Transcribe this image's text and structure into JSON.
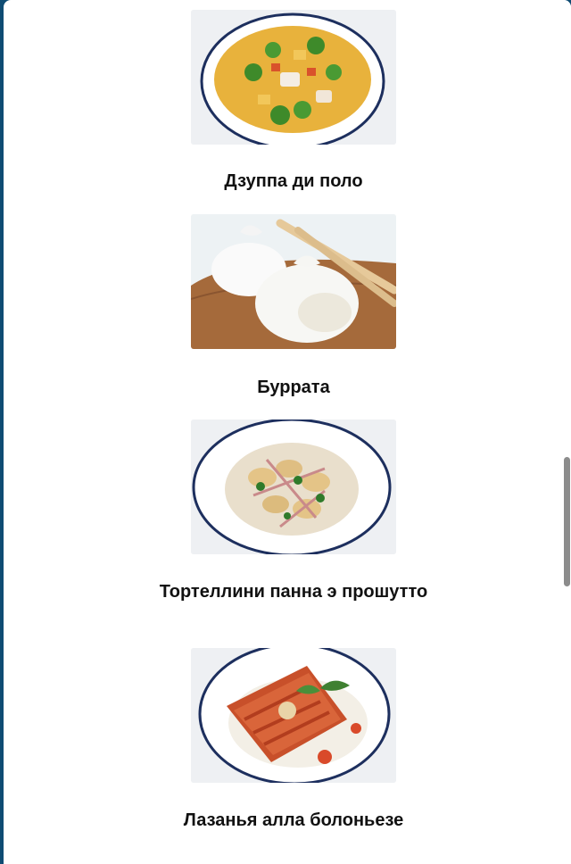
{
  "menu": {
    "items": [
      {
        "name": "Дзуппа ди поло",
        "image": "chicken-soup-photo"
      },
      {
        "name": "Буррата",
        "image": "burrata-photo"
      },
      {
        "name": "Тортеллини панна э прошутто",
        "image": "tortellini-photo"
      },
      {
        "name": "Лазанья алла болоньезе",
        "image": "lasagna-photo"
      }
    ]
  },
  "scrollbar": {
    "position_fraction": 0.6
  }
}
